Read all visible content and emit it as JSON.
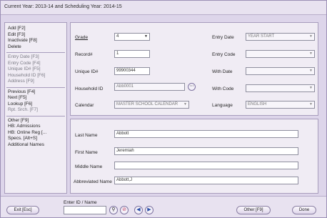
{
  "header": {
    "title": "Current Year: 2013-14 and Scheduling Year: 2014-15"
  },
  "sidebar": {
    "groups": [
      {
        "items": [
          {
            "label": "Add [F2]",
            "disabled": false
          },
          {
            "label": "Edit [F3]",
            "disabled": false
          },
          {
            "label": "Inactivate [F8]",
            "disabled": false
          },
          {
            "label": "Delete",
            "disabled": false
          }
        ]
      },
      {
        "items": [
          {
            "label": "Entry Date [F3]",
            "disabled": true
          },
          {
            "label": "Entry Code [F4]",
            "disabled": true
          },
          {
            "label": "Unique ID# [F5]",
            "disabled": true
          },
          {
            "label": "Household ID [F6]",
            "disabled": true
          },
          {
            "label": "Address [F9]",
            "disabled": true
          }
        ]
      },
      {
        "items": [
          {
            "label": "Previous [F4]",
            "disabled": false
          },
          {
            "label": "Next [F5]",
            "disabled": false
          },
          {
            "label": "Lookup [F6]",
            "disabled": false
          },
          {
            "label": "Rpt. Srch. [F7]",
            "disabled": true
          }
        ]
      },
      {
        "items": [
          {
            "label": "Other [F9]",
            "disabled": false
          },
          {
            "label": "HB: Admissions",
            "disabled": false
          },
          {
            "label": "HB: Online Reg [...",
            "disabled": false
          },
          {
            "label": "Specs. [Alt+S]",
            "disabled": false
          },
          {
            "label": "Additional Names",
            "disabled": false
          }
        ]
      }
    ]
  },
  "form": {
    "grade": {
      "label": "Grade",
      "value": "4"
    },
    "record": {
      "label": "Record#",
      "value": "1"
    },
    "unique_id": {
      "label": "Unique ID#",
      "value": "99900344"
    },
    "household_id": {
      "label": "Household ID",
      "value": "Abb0001"
    },
    "calendar": {
      "label": "Calendar",
      "value": "MASTER SCHOOL CALENDAR"
    },
    "entry_date": {
      "label": "Entry Date",
      "value": "YEAR START"
    },
    "entry_code": {
      "label": "Entry Code",
      "value": ""
    },
    "with_date": {
      "label": "With Date",
      "value": ""
    },
    "with_code": {
      "label": "With Code",
      "value": ""
    },
    "language": {
      "label": "Language",
      "value": "ENGLISH"
    }
  },
  "names": {
    "last_name": {
      "label": "Last Name",
      "value": "Abbott"
    },
    "first_name": {
      "label": "First Name",
      "value": "Jeremiah"
    },
    "middle_name": {
      "label": "Middle Name",
      "value": ""
    },
    "abbreviated_name": {
      "label": "Abbreviated Name",
      "value": "Abbott,J"
    }
  },
  "footer": {
    "exit_label": "Exit [Esc]",
    "enter_id_label": "Enter ID / Name",
    "enter_id_value": "",
    "other_label": "Other [F9]",
    "done_label": "Done"
  }
}
